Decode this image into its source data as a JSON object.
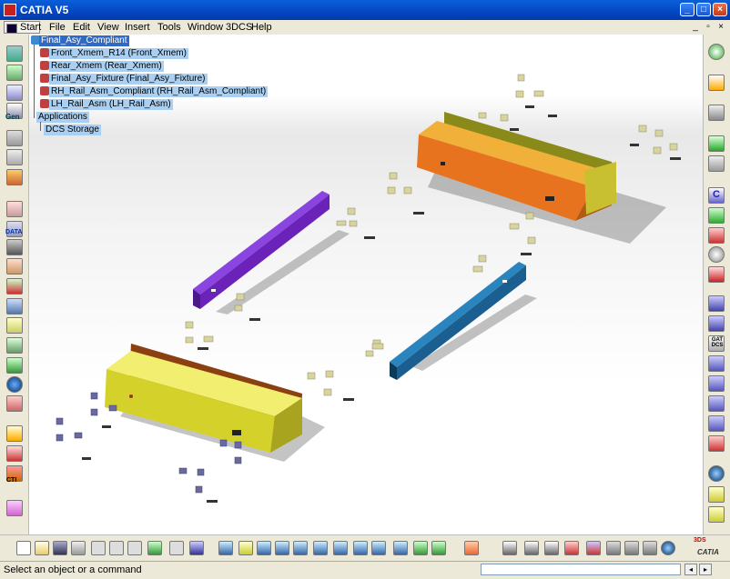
{
  "window": {
    "title": "CATIA V5",
    "minimize": "_",
    "maximize": "□",
    "close": "×"
  },
  "menu": {
    "start": "Start",
    "items": [
      "File",
      "Edit",
      "View",
      "Insert",
      "Tools",
      "Window",
      "3DCS",
      "Help"
    ]
  },
  "mdi_controls": {
    "minimize": "_",
    "restore": "▫",
    "close": "×"
  },
  "tree": {
    "root": "Final_Asy_Compliant",
    "children": [
      "Front_Xmem_R14 (Front_Xmem)",
      "Rear_Xmem (Rear_Xmem)",
      "Final_Asy_Fixture (Final_Asy_Fixture)",
      "RH_Rail_Asm_Compliant (RH_Rail_Asm_Compliant)",
      "LH_Rail_Asm (LH_Rail_Asm)"
    ],
    "applications": "Applications",
    "storage": "DCS Storage"
  },
  "left_toolbar": {
    "gen_label": "Gen",
    "data_label": "DATA",
    "cti_label": "CTI"
  },
  "right_toolbar": {
    "c_label": "C",
    "gat_label": "GAT DCS"
  },
  "statusbar": {
    "message": "Select an object or a command",
    "command_value": ""
  },
  "branding": {
    "logo_text": "CATIA",
    "logo_prefix": "3DS"
  },
  "colors": {
    "titlebar": "#0a5fd8",
    "tree_selected": "#316ac5",
    "tree_node": "#a9d0f3",
    "rear_xmem": "#e8731e",
    "front_xmem": "#d4d22a",
    "lh_rail": "#6b22b8",
    "rh_rail": "#1a5f8f"
  }
}
